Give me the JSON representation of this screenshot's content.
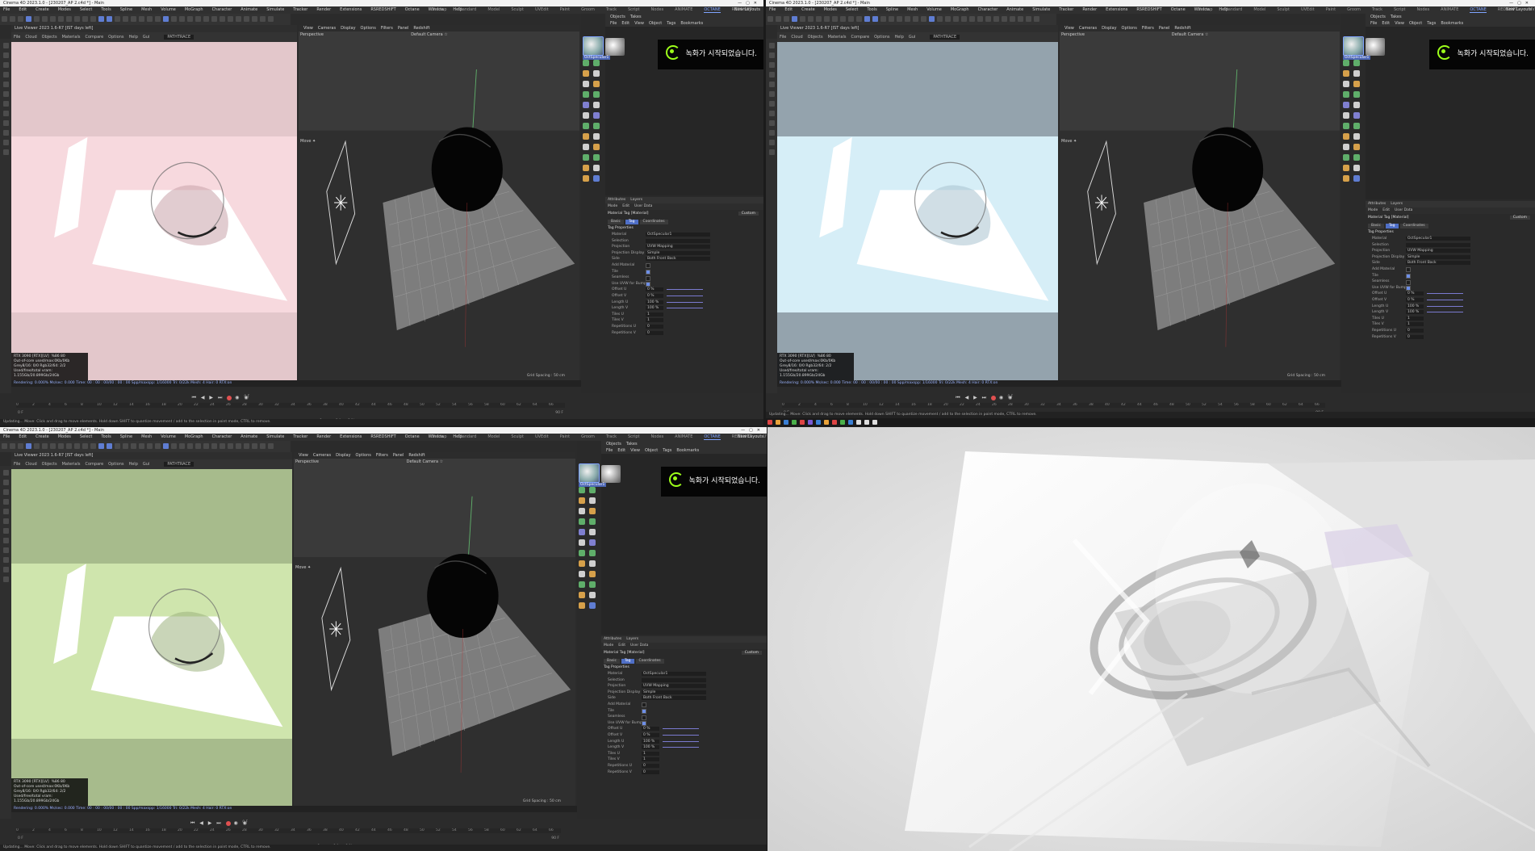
{
  "window_title_q1": "Cinema 4D 2023.1.0 - [230207_AP 2.c4d *] - Main",
  "window_title_q2": "Cinema 4D 2023.1.0 - [230207_AP 2.c4d *] - Main",
  "window_title_q3": "Cinema 4D 2023.1.0 - [230207_AP 2.c4d *] - Main",
  "menu": [
    "File",
    "Edit",
    "Create",
    "Modes",
    "Select",
    "Tools",
    "Spline",
    "Mesh",
    "Volume",
    "MoGraph",
    "Character",
    "Animate",
    "Simulate",
    "Tracker",
    "Render",
    "Extensions",
    "RSREDSHIFT",
    "Octane",
    "Window",
    "Help"
  ],
  "layouts": [
    "Startup",
    "Standard",
    "Model",
    "Sculpt",
    "UVEdit",
    "Paint",
    "Groom",
    "Track",
    "Script",
    "Nodes",
    "ANIMATE",
    "OCTANE",
    "REDSHIFT",
    "UV"
  ],
  "active_layout": "OCTANE",
  "new_layouts": "New Layouts",
  "live_viewer_title": "Live Viewer 2023 1.6-R7 [IST days left]",
  "live_viewer_menu": [
    "File",
    "Cloud",
    "Objects",
    "Materials",
    "Compare",
    "Options",
    "Help",
    "Gui"
  ],
  "render_mode": "PATHTRACE",
  "viewport": {
    "menu": [
      "View",
      "Cameras",
      "Display",
      "Options",
      "Filters",
      "Panel",
      "Redshift"
    ],
    "label": "Perspective",
    "camera": "Default Camera ☆",
    "move": "Move ✦",
    "grid_spacing": "Grid Spacing : 50 cm"
  },
  "stats": {
    "gpu": "RTX 3090 [RTX][LV]",
    "gpu_val": "%86   80",
    "line2": "Out-of-core used/max:0Kb/0Kb",
    "line3": "Grey8/16: 0/0      Rgb32/64: 2/2",
    "line4": "Used/free/total vram: 1.155Gb/20.899Gb/24Gb"
  },
  "render_status": "Rendering: 0.000%   Ms/sec: 0.000   Time: 00 : 00 : 00/00 : 00 : 00   Spp/maxspp: 1/16000   Tri: 0/22k   Mesh: 4   Hair: 0   RTX:on",
  "objects_menu": [
    "File",
    "Edit",
    "View",
    "Object",
    "Tags",
    "Bookmarks"
  ],
  "objects_tab": "Objects",
  "takes_tab": "Takes",
  "materials": [
    "OctSpecular1",
    "OctDiffuse1"
  ],
  "recording_toast": "녹화가 시작되었습니다.",
  "attributes": {
    "tabs_header": [
      "Attributes",
      "Layers"
    ],
    "menu": [
      "Mode",
      "Edit",
      "User Data"
    ],
    "tag_title": "Material Tag [Material]",
    "custom": "Custom",
    "subtabs": [
      "Basic",
      "Tag",
      "Coordinates"
    ],
    "section": "Tag Properties",
    "rows": [
      {
        "label": "Material",
        "value": "OctSpecular1",
        "kind": "field-wide"
      },
      {
        "label": "Selection",
        "value": "",
        "kind": "field-wide"
      },
      {
        "label": "Projection",
        "value": "UVW Mapping",
        "kind": "field-wide"
      },
      {
        "label": "Projection Display",
        "value": "Simple",
        "kind": "field-wide"
      },
      {
        "label": "Side",
        "value": "Both      Front      Back",
        "kind": "field-wide"
      },
      {
        "label": "Add Material",
        "value": "",
        "kind": "check"
      },
      {
        "label": "Tile",
        "value": "",
        "kind": "check-on"
      },
      {
        "label": "Seamless",
        "value": "",
        "kind": "check"
      },
      {
        "label": "Use UVW for Bump",
        "value": "",
        "kind": "check-on"
      },
      {
        "label": "Offset U",
        "value": "0 %",
        "kind": "slider"
      },
      {
        "label": "Offset V",
        "value": "0 %",
        "kind": "slider"
      },
      {
        "label": "Length U",
        "value": "100 %",
        "kind": "slider"
      },
      {
        "label": "Length V",
        "value": "100 %",
        "kind": "slider"
      },
      {
        "label": "Tiles U",
        "value": "1",
        "kind": "field"
      },
      {
        "label": "Tiles V",
        "value": "1",
        "kind": "field"
      },
      {
        "label": "Repetitions U",
        "value": "0",
        "kind": "field"
      },
      {
        "label": "Repetitions V",
        "value": "0",
        "kind": "field"
      }
    ]
  },
  "timeline": {
    "ticks": [
      "0",
      "2",
      "4",
      "6",
      "8",
      "10",
      "12",
      "14",
      "16",
      "18",
      "20",
      "22",
      "24",
      "26",
      "28",
      "30",
      "32",
      "34",
      "36",
      "38",
      "40",
      "42",
      "44",
      "46",
      "48",
      "50",
      "52",
      "54",
      "56",
      "58",
      "60",
      "62",
      "64",
      "66",
      "68",
      "70",
      "72",
      "74",
      "76",
      "78",
      "80",
      "82",
      "84",
      "86",
      "88",
      "90"
    ],
    "frame": "0 F",
    "start": "0 F",
    "end": "90 F",
    "frames_a": "0 cm",
    "frames_b": "0 °",
    "frames_c": "0 %"
  },
  "statusbar": "Updating...   Move: Click and drag to move elements. Hold down SHIFT to quantize movement / add to the selection in point mode, CTRL to remove.",
  "colors": {
    "pink_bg": "#e3c7cb",
    "pink_mid": "#f7d9de",
    "blue_bg": "#94a3ad",
    "blue_mid": "#d6eef7",
    "green_bg": "#a7bb8c",
    "green_mid": "#cfe5ad",
    "accent": "#5f7dd2"
  }
}
